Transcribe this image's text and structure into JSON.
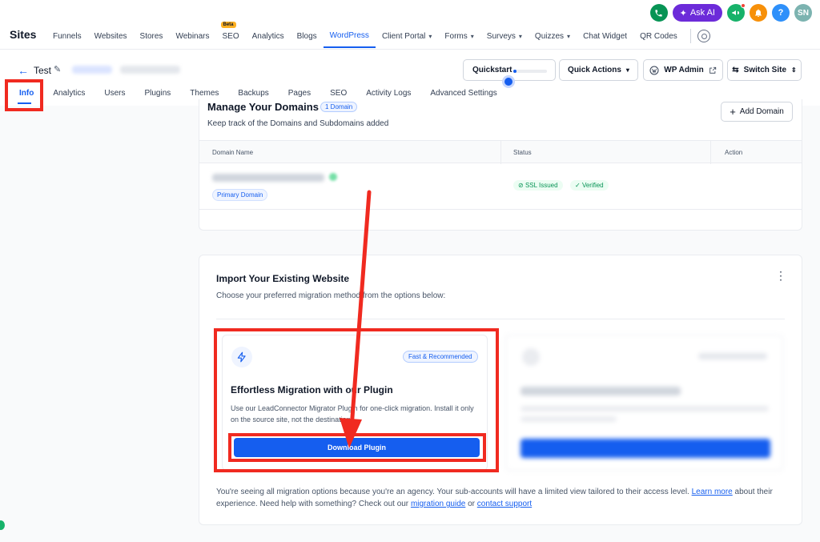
{
  "topnav": {
    "brand": "Sites",
    "items": [
      {
        "label": "Funnels"
      },
      {
        "label": "Websites"
      },
      {
        "label": "Stores"
      },
      {
        "label": "Webinars"
      },
      {
        "label": "SEO",
        "badge": "Beta"
      },
      {
        "label": "Analytics"
      },
      {
        "label": "Blogs"
      },
      {
        "label": "WordPress",
        "active": true
      },
      {
        "label": "Client Portal",
        "dropdown": true
      },
      {
        "label": "Forms",
        "dropdown": true
      },
      {
        "label": "Surveys",
        "dropdown": true
      },
      {
        "label": "Quizzes",
        "dropdown": true
      },
      {
        "label": "Chat Widget"
      },
      {
        "label": "QR Codes"
      }
    ],
    "ask_ai": "Ask AI",
    "help_label": "?",
    "avatar_initials": "SN"
  },
  "site": {
    "title": "Test",
    "quickstart_label": "Quickstart",
    "quickstart_progress": 0.05,
    "quick_actions_label": "Quick Actions",
    "wp_admin_label": "WP Admin",
    "switch_site_label": "Switch Site"
  },
  "tabs": [
    {
      "label": "Info",
      "active": true
    },
    {
      "label": "Analytics"
    },
    {
      "label": "Users"
    },
    {
      "label": "Plugins"
    },
    {
      "label": "Themes"
    },
    {
      "label": "Backups"
    },
    {
      "label": "Pages"
    },
    {
      "label": "SEO"
    },
    {
      "label": "Activity Logs"
    },
    {
      "label": "Advanced Settings"
    }
  ],
  "domains": {
    "title": "Manage Your Domains",
    "count_badge": "1 Domain",
    "subtitle": "Keep track of the Domains and Subdomains added",
    "add_button": "Add Domain",
    "columns": [
      "Domain Name",
      "Status",
      "Action"
    ],
    "row": {
      "primary_badge": "Primary Domain",
      "ssl_status": "SSL Issued",
      "verified_status": "Verified"
    }
  },
  "import": {
    "title": "Import Your Existing Website",
    "subtitle": "Choose your preferred migration method from the options below:",
    "option1": {
      "badge": "Fast & Recommended",
      "title": "Effortless Migration with our Plugin",
      "description": "Use our LeadConnector Migrator Plugin for one-click migration. Install it only on the source site, not the destination.",
      "button": "Download Plugin"
    },
    "footnote": {
      "part1": "You're seeing all migration options because you're an agency. Your sub-accounts will have a limited view tailored to their access level.",
      "learn_more": "Learn more",
      "part2": "about their experience. Need help with something? Check out our",
      "guide": "migration guide",
      "part3": "or",
      "support": "contact support"
    }
  },
  "colors": {
    "accent": "#155eef",
    "annotation_red": "#f02a20",
    "success": "#079455"
  }
}
